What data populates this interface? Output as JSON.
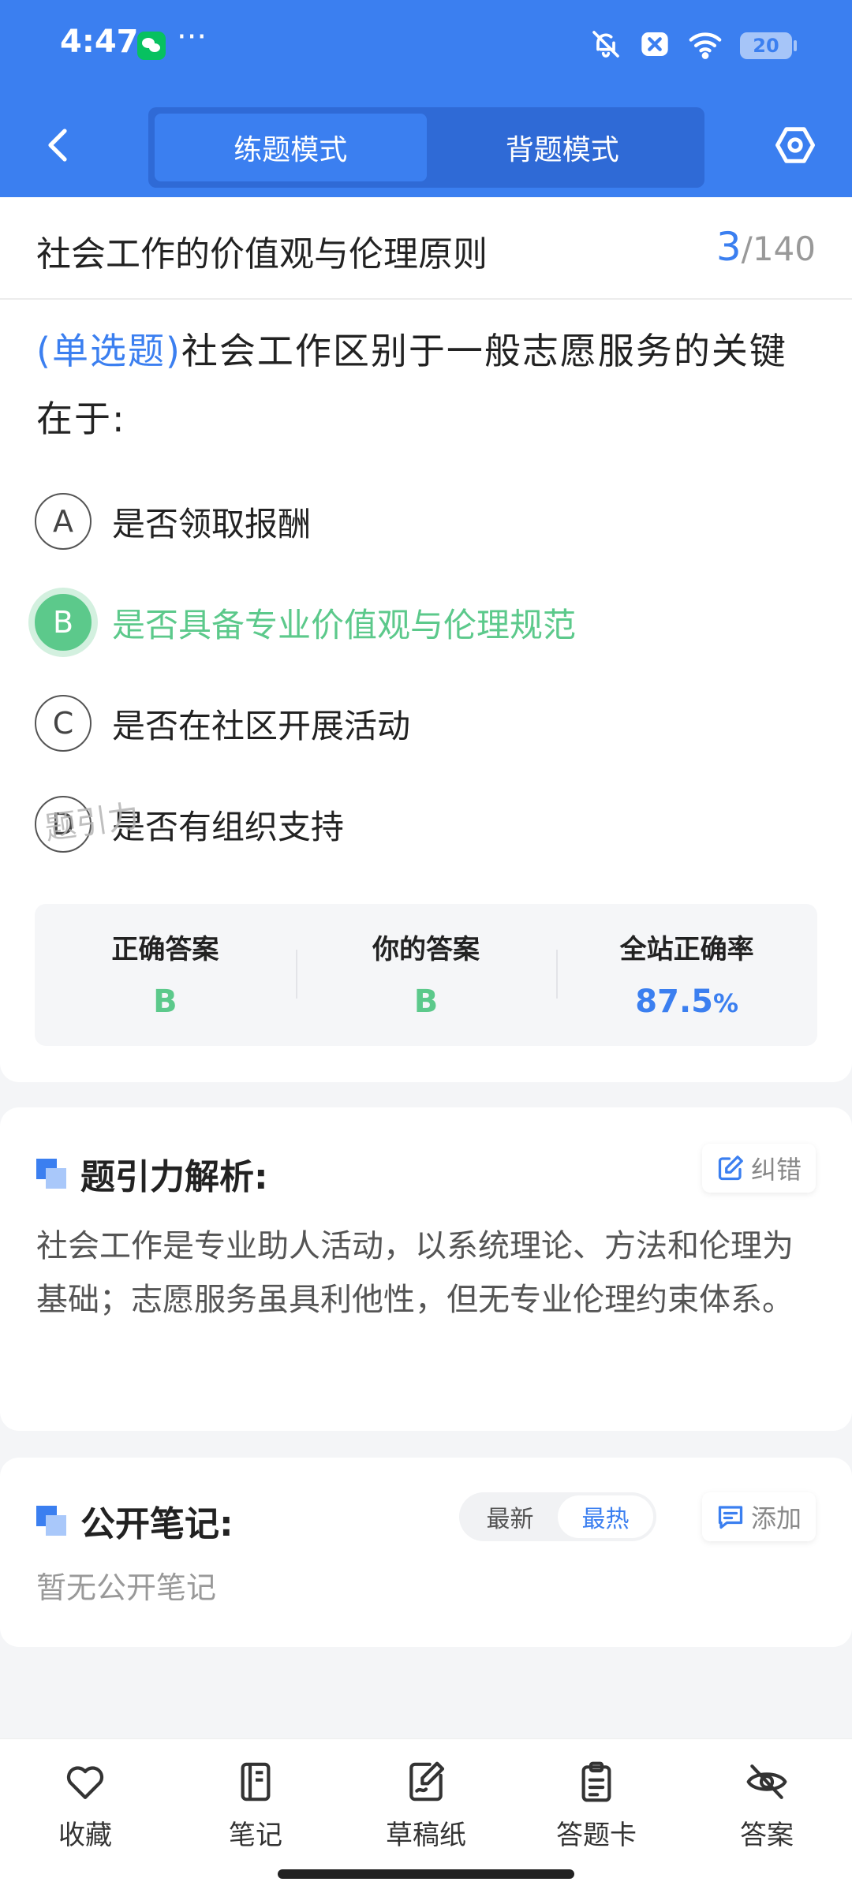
{
  "status_bar": {
    "time": "4:47",
    "more": "···",
    "battery": "20",
    "icons": [
      "wechat-icon",
      "bell-off-icon",
      "close-box-icon",
      "wifi-icon",
      "battery-icon"
    ]
  },
  "nav": {
    "back_icon": "chevron-left-icon",
    "modes": [
      {
        "label": "练题模式",
        "active": true
      },
      {
        "label": "背题模式",
        "active": false
      }
    ],
    "settings_icon": "hexagon-settings-icon"
  },
  "chapter": {
    "title": "社会工作的价值观与伦理原则",
    "current": "3",
    "separator": "/",
    "total": "140"
  },
  "question": {
    "type": "(单选题)",
    "text": "社会工作区别于一般志愿服务的关键在于:",
    "options": [
      {
        "letter": "A",
        "text": "是否领取报酬",
        "state": "normal"
      },
      {
        "letter": "B",
        "text": "是否具备专业价值观与伦理规范",
        "state": "correct"
      },
      {
        "letter": "C",
        "text": "是否在社区开展活动",
        "state": "normal"
      },
      {
        "letter": "D",
        "text": "是否有组织支持",
        "state": "normal"
      }
    ]
  },
  "stats": {
    "correct_label": "正确答案",
    "correct_value": "B",
    "yours_label": "你的答案",
    "yours_value": "B",
    "rate_label": "全站正确率",
    "rate_value": "87.5",
    "rate_unit": "%",
    "watermark": "题引力"
  },
  "analysis": {
    "title": "题引力解析:",
    "report_label": "纠错",
    "text": "社会工作是专业助人活动，以系统理论、方法和伦理为基础；志愿服务虽具利他性，但无专业伦理约束体系。"
  },
  "notes": {
    "title": "公开笔记:",
    "sort_latest": "最新",
    "sort_hot": "最热",
    "add_label": "添加",
    "empty_text": "暂无公开笔记"
  },
  "bottom_bar": {
    "items": [
      {
        "label": "收藏",
        "icon": "heart-icon"
      },
      {
        "label": "笔记",
        "icon": "notebook-icon"
      },
      {
        "label": "草稿纸",
        "icon": "draft-paper-icon"
      },
      {
        "label": "答题卡",
        "icon": "answer-sheet-icon"
      },
      {
        "label": "答案",
        "icon": "eye-off-icon"
      }
    ]
  },
  "colors": {
    "primary": "#3b7ff0",
    "correct": "#5cc98b",
    "text": "#222222",
    "muted": "#999999"
  }
}
